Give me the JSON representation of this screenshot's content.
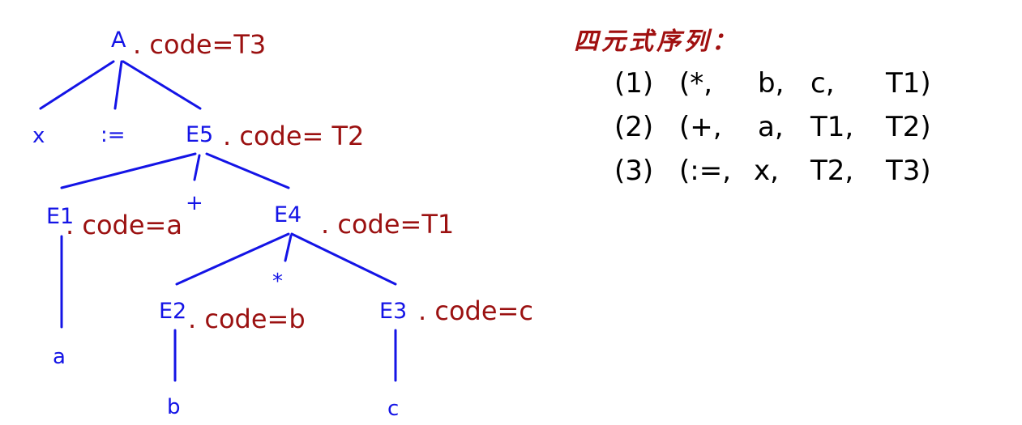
{
  "tree": {
    "nodes": {
      "A": "A",
      "x": "x",
      "assign": ":=",
      "E5": "E5",
      "E1": "E1",
      "plus": "+",
      "E4": "E4",
      "a": "a",
      "E2": "E2",
      "star": "*",
      "E3": "E3",
      "b": "b",
      "c": "c"
    },
    "attributes": {
      "A": ". code=T3",
      "E5": ". code= T2",
      "E1": ". code=a",
      "E4": ". code=T1",
      "E2": ". code=b",
      "E3": ". code=c"
    }
  },
  "quadruples": {
    "title": "四元式序列：",
    "rows": [
      {
        "no": "(1)",
        "op": "(*,",
        "arg1": "b,",
        "arg2": "c,",
        "result": "T1)"
      },
      {
        "no": "(2)",
        "op": "(+,",
        "arg1": "a,",
        "arg2": "T1,",
        "result": "T2)"
      },
      {
        "no": "(3)",
        "op": "(:=,",
        "arg1": "x,",
        "arg2": "T2,",
        "result": "T3)"
      }
    ]
  },
  "colors": {
    "node": "#1414e6",
    "attribute": "#9b1111",
    "title": "#a01010",
    "quadruple": "#000000"
  }
}
